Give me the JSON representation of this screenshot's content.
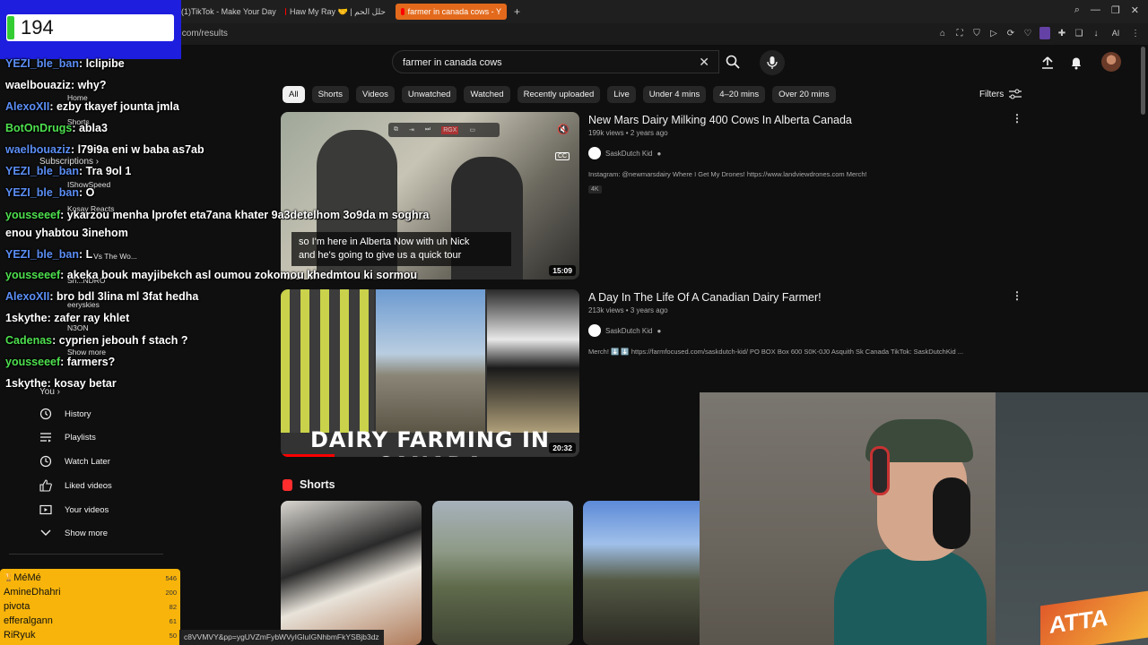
{
  "browser": {
    "tabs": [
      {
        "label": "(1)TikTok - Make Your Day",
        "active": false
      },
      {
        "label": "Haw My Ray 🤝 | حلل الحم",
        "active": false
      },
      {
        "label": "farmer in canada cows - Y",
        "active": true
      }
    ],
    "new_tab": "+",
    "url": ".com/results",
    "ai_label": "AI"
  },
  "youtube": {
    "search_query": "farmer in canada cows",
    "chips": [
      "All",
      "Shorts",
      "Videos",
      "Unwatched",
      "Watched",
      "Recently uploaded",
      "Live",
      "Under 4 mins",
      "4–20 mins",
      "Over 20 mins"
    ],
    "active_chip": "All",
    "filters_label": "Filters",
    "results": [
      {
        "title": "New Mars Dairy Milking 400 Cows In Alberta Canada",
        "meta": "199k views • 2 years ago",
        "channel": "SaskDutch Kid",
        "description": "Instagram: @newmarsdairy Where I Get My Drones! https://www.landviewdrones.com Merch!",
        "badge": "4K",
        "duration": "15:09",
        "caption_line1": "so I'm here in Alberta Now with uh Nick",
        "caption_line2": "and he's going to give us a quick tour"
      },
      {
        "title": "A Day In The Life Of A Canadian Dairy Farmer!",
        "meta": "213k views • 3 years ago",
        "channel": "SaskDutch Kid",
        "description": "Merch! ⬇️ ⬇️ https://farmfocused.com/saskdutch-kid/ PO BOX Box 600 S0K-0J0 Asquith Sk Canada TikTok: SaskDutchKid ...",
        "duration": "20:32",
        "thumb_text": "DAIRY FARMING IN CANADA"
      }
    ],
    "shorts_label": "Shorts",
    "player_controls": [
      "RGX"
    ]
  },
  "sidebar": {
    "faint": [
      {
        "label": "Home"
      },
      {
        "label": "Shorts"
      },
      {
        "label": "Subscriptions ›"
      },
      {
        "label": "IShowSpeed"
      },
      {
        "label": "Kosay Reacts"
      },
      {
        "label": "...Vs The Wo..."
      },
      {
        "label": "Sh...NDRO"
      },
      {
        "label": "eeryskies"
      },
      {
        "label": "N3ON"
      },
      {
        "label": "Show more"
      },
      {
        "label": "You ›"
      }
    ],
    "items": [
      {
        "label": "History",
        "icon": "history-icon"
      },
      {
        "label": "Playlists",
        "icon": "playlists-icon"
      },
      {
        "label": "Watch Later",
        "icon": "watch-later-icon"
      },
      {
        "label": "Liked videos",
        "icon": "liked-videos-icon"
      },
      {
        "label": "Your videos",
        "icon": "your-videos-icon"
      },
      {
        "label": "Show more",
        "icon": "chevron-down-icon"
      }
    ]
  },
  "overlay": {
    "counter_value": "194",
    "chat": [
      {
        "user": "YEZI_ble_ban",
        "msg": ": lclipibe",
        "color": "blue"
      },
      {
        "user": "waelbouaziz",
        "msg": ": why?",
        "color": "white"
      },
      {
        "user": "AlexoXII",
        "msg": ": ezby tkayef jounta jmla",
        "color": "blue"
      },
      {
        "user": "BotOnDrugs",
        "msg": ": abla3",
        "color": "green"
      },
      {
        "user": "waelbouaziz",
        "msg": ": l79i9a eni w baba as7ab",
        "color": "blue"
      },
      {
        "user": "YEZI_ble_ban",
        "msg": ": Tra 9ol 1",
        "color": "blue"
      },
      {
        "user": "YEZI_ble_ban",
        "msg": ": O",
        "color": "blue"
      },
      {
        "user": "yousseeef",
        "msg": ": ykarzou menha lprofet eta7ana khater 9a3detelhom 3o9da m soghra",
        "color": "green"
      },
      {
        "user": "",
        "msg": "enou yhabtou 3inehom",
        "color": "white"
      },
      {
        "user": "YEZI_ble_ban",
        "msg": ": L",
        "color": "blue"
      },
      {
        "user": "yousseeef",
        "msg": ": akeka bouk mayjibekch asl oumou zokomou khedmtou ki sormou",
        "color": "green"
      },
      {
        "user": "AlexoXII",
        "msg": ": bro bdl 3lina ml 3fat hedha",
        "color": "blue"
      },
      {
        "user": "1skythe",
        "msg": ": zafer ray khlet",
        "color": "white"
      },
      {
        "user": "Cadenas",
        "msg": ": cyprien jebouh f stach ?",
        "color": "green"
      },
      {
        "user": "yousseeef",
        "msg": ": farmers?",
        "color": "green"
      },
      {
        "user": "1skythe",
        "msg": ": kosay betar",
        "color": "white"
      }
    ],
    "leaderboard": [
      {
        "name": "MéMé",
        "value": "546",
        "trophy": true
      },
      {
        "name": "AmineDhahri",
        "value": "200"
      },
      {
        "name": "pivota",
        "value": "82"
      },
      {
        "name": "efferalgann",
        "value": "61"
      },
      {
        "name": "RiRyuk",
        "value": "50"
      }
    ],
    "status_url": "c8VVMVY&pp=ygUVZmFybWVyIGluIGNhbmFkYSBjb3dz",
    "webcam_text": "ATTA"
  }
}
